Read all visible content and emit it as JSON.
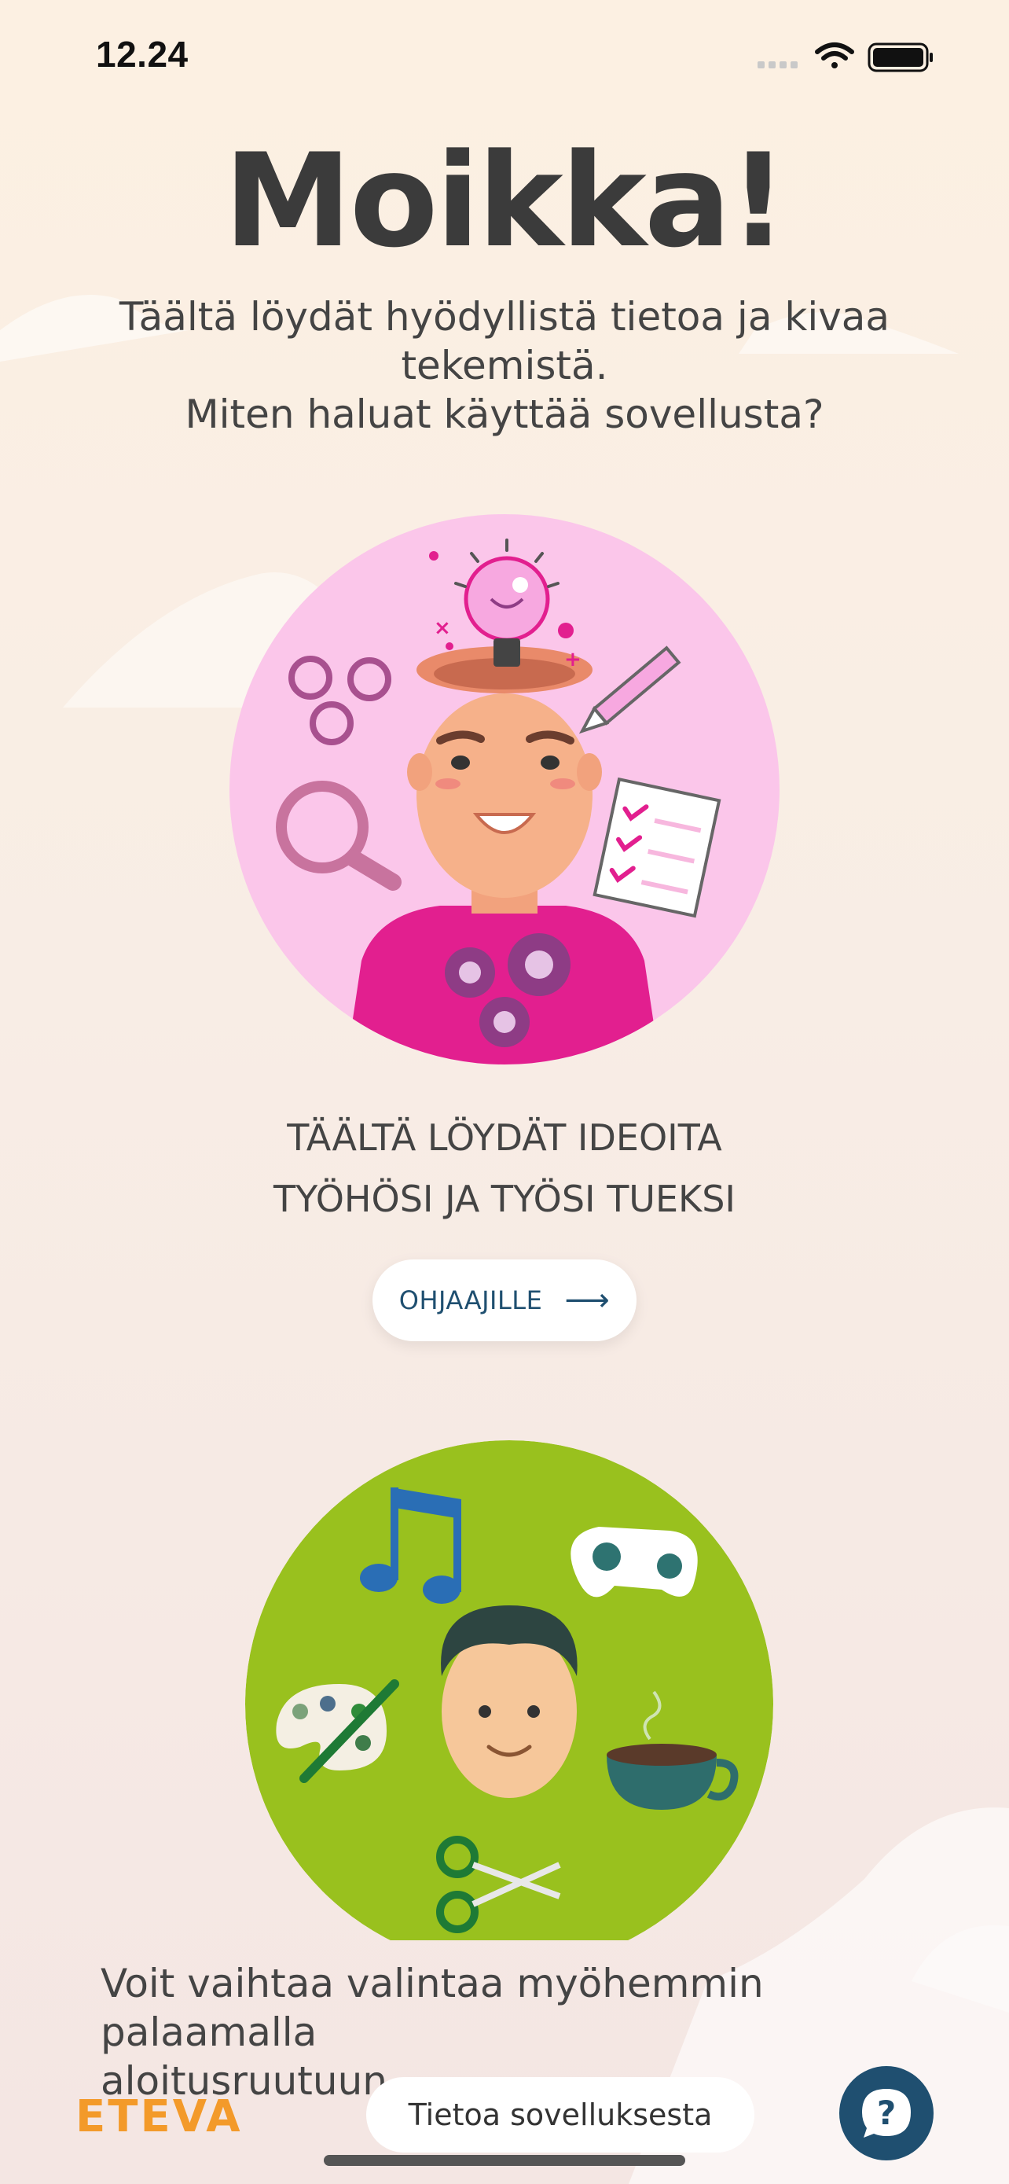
{
  "status_bar": {
    "time": "12.24"
  },
  "header": {
    "title": "Moikka!"
  },
  "intro": {
    "line1": "Täältä löydät hyödyllistä tietoa ja kivaa",
    "line2": "tekemistä.",
    "line3": "Miten haluat käyttää sovellusta?"
  },
  "option_supervisors": {
    "caption_line1": "TÄÄLTÄ LÖYDÄT IDEOITA",
    "caption_line2": "TYÖHÖSI JA TYÖSI TUEKSI",
    "button_label": "OHJAAJILLE",
    "button_arrow": "⟶",
    "circle_color": "#fbc6ea"
  },
  "option_leisure": {
    "circle_color": "#99c11e"
  },
  "footer": {
    "hint_line1": "Voit vaihtaa valintaa myöhemmin palaamalla",
    "hint_line2": "aloitusruutuun.",
    "logo_text": "ETEVA",
    "info_button_label": "Tietoa sovelluksesta",
    "help_icon": "question-bubble-icon"
  },
  "colors": {
    "accent": "#1f4f70",
    "logo": "#f39a2a",
    "background": "#fcf0e2"
  }
}
